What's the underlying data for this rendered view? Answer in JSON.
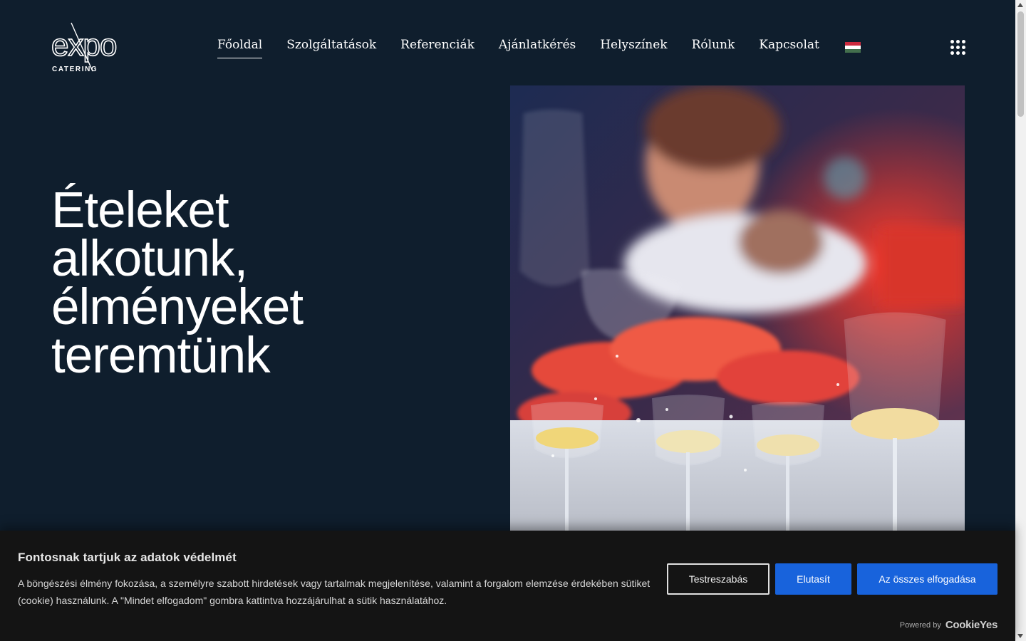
{
  "brand": {
    "logo_word": "expo",
    "logo_sub": "CATERING"
  },
  "nav": {
    "items": [
      {
        "label": "Főoldal",
        "active": true
      },
      {
        "label": "Szolgáltatások",
        "active": false
      },
      {
        "label": "Referenciák",
        "active": false
      },
      {
        "label": "Ajánlatkérés",
        "active": false
      },
      {
        "label": "Helyszínek",
        "active": false
      },
      {
        "label": "Rólunk",
        "active": false
      },
      {
        "label": "Kapcsolat",
        "active": false
      }
    ],
    "language_flag": "hungarian-flag-icon",
    "menu_icon": "grid-menu-icon"
  },
  "hero": {
    "lines": [
      "Ételeket",
      "alkotunk,",
      "élményeket",
      "teremtünk"
    ],
    "image": "wine-glasses-photo"
  },
  "cookie_banner": {
    "title": "Fontosnak tartjuk az adatok védelmét",
    "text": "A böngészési élmény fokozása, a személyre szabott hirdetések vagy tartalmak megjelenítése, valamint a forgalom elemzése érdekében sütiket (cookie) használunk. A \"Mindet elfogadom\" gombra kattintva hozzájárulhat a sütik használatához.",
    "customize_label": "Testreszabás",
    "reject_label": "Elutasít",
    "accept_label": "Az összes elfogadása",
    "powered_label": "Powered by",
    "powered_brand": "CookieYes"
  },
  "colors": {
    "background": "#0f1e2d",
    "accent_button": "#1863dc",
    "banner_background": "#141414",
    "flag": [
      "#cd2a3e",
      "#ffffff",
      "#436f4d"
    ]
  }
}
